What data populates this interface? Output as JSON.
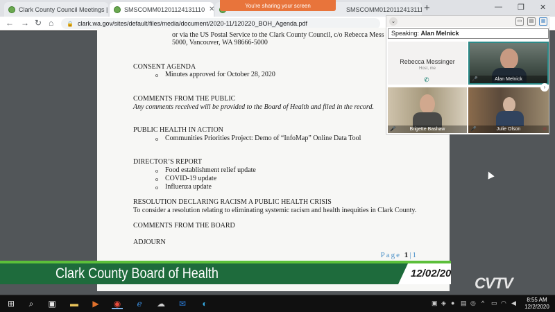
{
  "browser": {
    "tabs": [
      {
        "title": "Clark County Council Meetings |"
      },
      {
        "title": "SMSCOMM01201124131110"
      },
      {
        "title": "SMSCOMM01201124131110"
      }
    ],
    "share_banner": "You're sharing your screen",
    "url": "clark.wa.gov/sites/default/files/media/document/2020-11/120220_BOH_Agenda.pdf"
  },
  "document": {
    "lines": {
      "postal_1": "or via the US Postal Service to the Clark County Council, c/o Rebecca Mess",
      "postal_2": "5000, Vancouver, WA 98666-5000",
      "consent_heading": "CONSENT AGENDA",
      "consent_item": "Minutes approved for October 28, 2020",
      "comments_heading": "COMMENTS FROM THE PUBLIC",
      "comments_note": "Any comments received will be provided to the Board of Health and filed in the record.",
      "ph_heading": "PUBLIC HEALTH IN ACTION",
      "ph_item": "Communities Priorities Project:  Demo of “InfoMap” Online Data Tool",
      "director_heading": "DIRECTOR’S REPORT",
      "director_item_1": "Food establishment relief update",
      "director_item_2": "COVID-19 update",
      "director_item_3": "Influenza update",
      "resolution_heading": "RESOLUTION DECLARING RACISM A PUBLIC HEALTH CRISIS",
      "resolution_text": "To consider a resolution relating to eliminating systemic racism and health inequities in Clark County.",
      "board_heading": "COMMENTS FROM THE BOARD",
      "adjourn": "ADJOURN"
    },
    "bullet_glyph": "o",
    "page_label": "Page",
    "page_current": "1",
    "page_total": "1"
  },
  "meeting": {
    "speaking_label": "Speaking:",
    "speaking_name": "Alan Melnick",
    "participants": [
      {
        "name": "Rebecca Messinger",
        "status": "Host, me"
      },
      {
        "name": "Alan Melnick"
      },
      {
        "name": "Brigette Bashaw"
      },
      {
        "name": "Julie Olson"
      }
    ]
  },
  "broadcast": {
    "title": "Clark County Board of Health",
    "date": "12/02/20",
    "logo": "CVTV"
  },
  "taskbar": {
    "time": "8:55 AM",
    "date": "12/2/2020"
  },
  "colors": {
    "lower_third_green": "#1e6b3c",
    "accent_green": "#5cbf3a",
    "share_orange": "#e8743b",
    "page_number_blue": "#4a90c8"
  }
}
